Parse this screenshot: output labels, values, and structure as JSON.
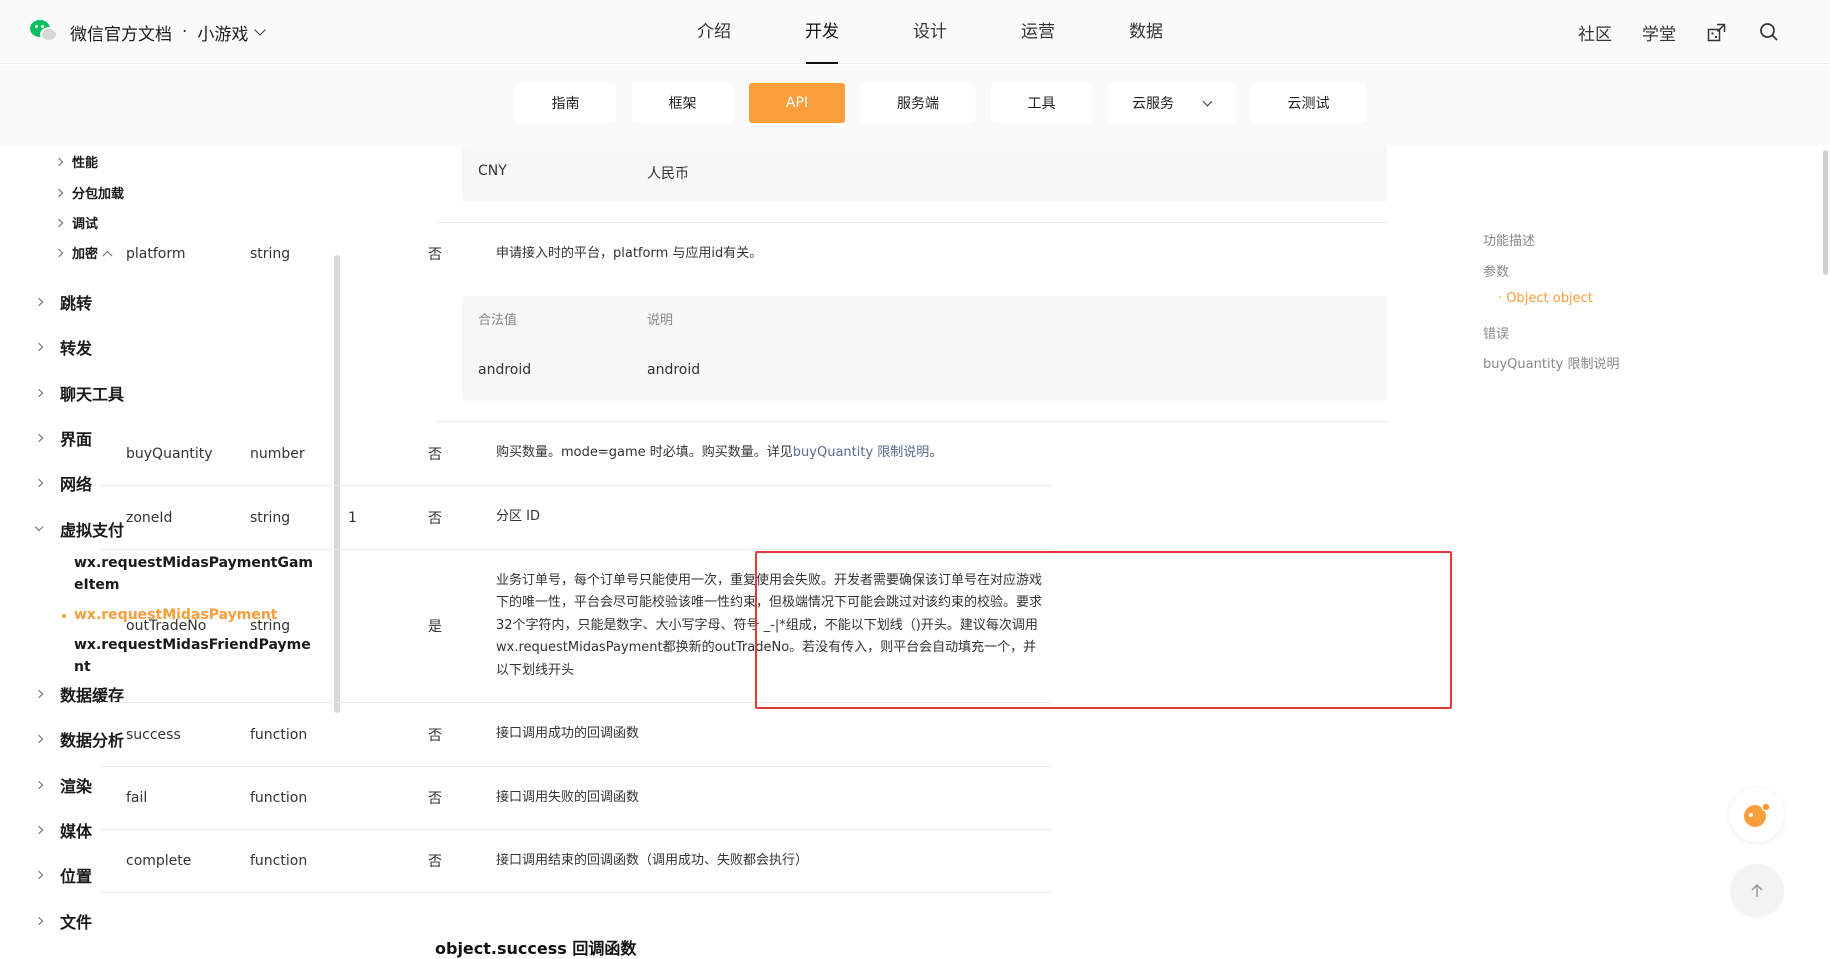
{
  "header": {
    "brand": "微信官方文档",
    "separator": "·",
    "product": "小游戏",
    "nav": [
      "介绍",
      "开发",
      "设计",
      "运营",
      "数据"
    ],
    "right": [
      "社区",
      "学堂"
    ],
    "icons": [
      "share-qr-icon",
      "search-icon"
    ]
  },
  "subnav": {
    "tabs": [
      "指南",
      "框架",
      "API",
      "服务端",
      "工具",
      "云服务",
      "云测试"
    ],
    "active": "API"
  },
  "sidebar": {
    "level2": [
      "性能",
      "分包加载",
      "调试",
      "加密"
    ],
    "groups_top": [
      "跳转",
      "转发",
      "聊天工具",
      "界面",
      "网络"
    ],
    "open_group": "虚拟支付",
    "children": [
      "wx.requestMidasPaymentGameItem",
      "wx.requestMidasPayment",
      "wx.requestMidasFriendPayment"
    ],
    "active_child": "wx.requestMidasPayment",
    "groups_bottom": [
      "数据缓存",
      "数据分析",
      "渲染",
      "媒体",
      "位置",
      "文件"
    ]
  },
  "table": {
    "cny": {
      "value": "CNY",
      "desc": "人民币"
    },
    "platform": {
      "name": "platform",
      "type": "string",
      "required": "否",
      "desc": "申请接入时的平台，platform 与应用id有关。"
    },
    "platform_values": {
      "h_value": "合法值",
      "h_desc": "说明",
      "value": "android",
      "desc": "android"
    },
    "buyQuantity": {
      "name": "buyQuantity",
      "type": "number",
      "required": "否",
      "desc": "购买数量。mode=game 时必填。购买数量。详见 ",
      "link": "buyQuantity 限制说明",
      "tail": "。"
    },
    "zoneId": {
      "name": "zoneId",
      "type": "string",
      "default": "1",
      "required": "否",
      "desc": "分区 ID"
    },
    "outTradeNo": {
      "name": "outTradeNo",
      "type": "string",
      "required": "是",
      "desc": "业务订单号，每个订单号只能使用一次，重复使用会失败。开发者需要确保该订单号在对应游戏下的唯一性，平台会尽可能校验该唯一性约束，但极端情况下可能会跳过对该约束的校验。要求32个字符内，只能是数字、大小写字母、符号 _-|*组成，不能以下划线（)开头。建议每次调用wx.requestMidasPayment都换新的outTradeNo。若没有传入，则平台会自动填充一个，并以下划线开头"
    },
    "success": {
      "name": "success",
      "type": "function",
      "required": "否",
      "desc": "接口调用成功的回调函数"
    },
    "fail": {
      "name": "fail",
      "type": "function",
      "required": "否",
      "desc": "接口调用失败的回调函数"
    },
    "complete": {
      "name": "complete",
      "type": "function",
      "required": "否",
      "desc": "接口调用结束的回调函数（调用成功、失败都会执行）"
    }
  },
  "section_heading": "object.success 回调函数",
  "toc": {
    "items": [
      "功能描述",
      "参数",
      "· Object object",
      "错误",
      "buyQuantity 限制说明"
    ],
    "active": "· Object object"
  },
  "colors": {
    "accent": "#fa9d3b",
    "link": "#576b95",
    "highlight": "#e53935",
    "brand_green": "#07c160"
  }
}
